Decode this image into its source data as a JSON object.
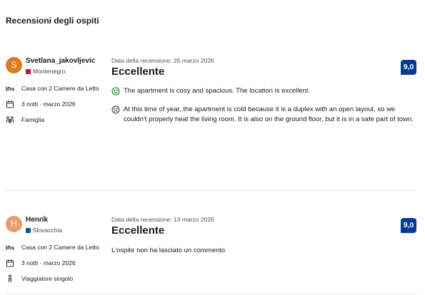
{
  "page": {
    "heading": "Recensioni degli ospiti"
  },
  "reviews": [
    {
      "avatar_letter": "S",
      "avatar_color": "#e07a1f",
      "name": "Svetlana_jakovljevic",
      "country": "Montenegro",
      "flag_color": "#c8102e",
      "room": "Casa con 2 Camere da Letto",
      "stay": "3 notti · marzo 2026",
      "traveler": "Famiglia",
      "date_label": "Data della recensione: 26 marzo 2026",
      "title": "Eccellente",
      "score": "9,0",
      "positive": "The apartment is cosy and spacious. The location is excellent.",
      "negative": "At this time of year, the apartment is cold because it is a duplex with an open layout, so we couldn't properly heat the living room. It is also on the ground floor, but it is in a safe part of town."
    },
    {
      "avatar_letter": "H",
      "avatar_color": "#ef9a6b",
      "name": "Henrik",
      "country": "Slovacchia",
      "flag_color": "#0b4ea2",
      "room": "Casa con 2 Camere da Letto",
      "stay": "3 notti · marzo 2026",
      "traveler": "Viaggiatore singolo",
      "date_label": "Data della recensione: 13 marzo 2026",
      "title": "Eccellente",
      "score": "9,0",
      "no_comment": "L'ospite non ha lasciato un commento"
    }
  ],
  "icons": {
    "room": "bed-icon",
    "stay": "calendar-icon",
    "family": "family-icon",
    "solo": "person-icon",
    "positive": "smile-icon",
    "negative": "frown-icon"
  }
}
